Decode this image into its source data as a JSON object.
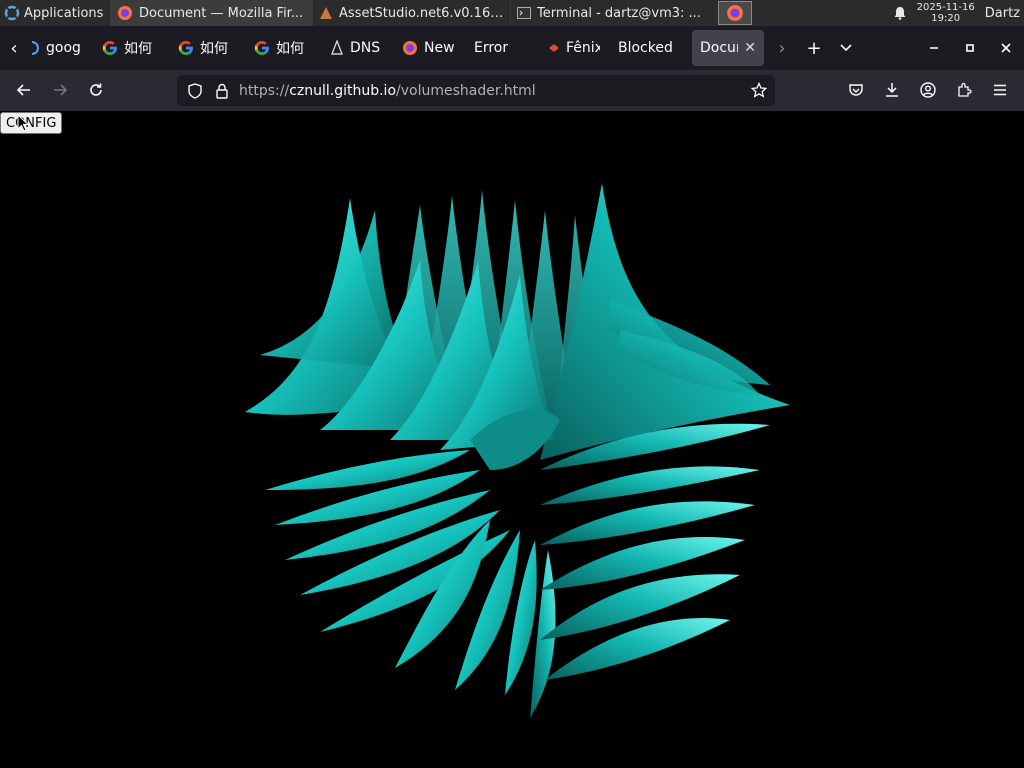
{
  "system_panel": {
    "applications_label": "Applications",
    "tasks": [
      {
        "label": "Document — Mozilla Fir...",
        "icon": "firefox-icon",
        "active": true
      },
      {
        "label": "AssetStudio.net6.v0.16....",
        "icon": "app-icon",
        "active": false
      },
      {
        "label": "Terminal - dartz@vm3: ...",
        "icon": "terminal-icon",
        "active": false
      }
    ],
    "clock_date": "2025-11-16",
    "clock_time": "19:20",
    "user": "Dartz"
  },
  "tabs": [
    {
      "label": "goog",
      "icon": "google-icon"
    },
    {
      "label": "如何",
      "icon": "google-icon"
    },
    {
      "label": "如何",
      "icon": "google-icon"
    },
    {
      "label": "如何",
      "icon": "google-icon"
    },
    {
      "label": "DNS",
      "icon": "dns-icon"
    },
    {
      "label": "New",
      "icon": "firefox-icon"
    },
    {
      "label": "Error",
      "icon": ""
    },
    {
      "label": "Fênix",
      "icon": "fenix-icon"
    },
    {
      "label": "Blocked",
      "icon": ""
    },
    {
      "label": "Docum",
      "icon": "",
      "selected": true
    }
  ],
  "navbar": {
    "url_scheme": "https://",
    "url_host": "cznull.github.io",
    "url_path": "/volumeshader.html"
  },
  "content": {
    "config_label": "CONFIG",
    "accent_color": "#1fc9c4"
  }
}
